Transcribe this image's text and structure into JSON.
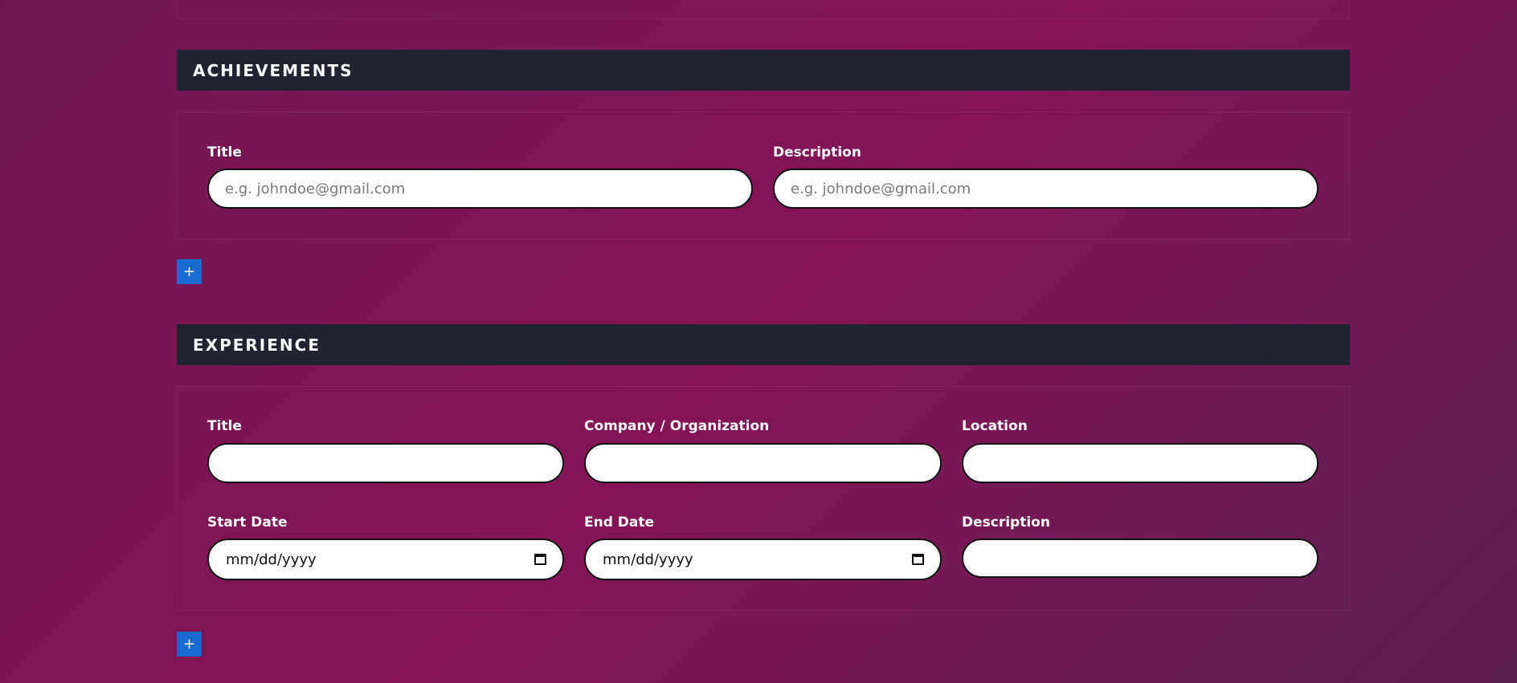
{
  "achievements": {
    "heading": "ACHIEVEMENTS",
    "fields": {
      "title": {
        "label": "Title",
        "value": "",
        "placeholder": "e.g. johndoe@gmail.com"
      },
      "description": {
        "label": "Description",
        "value": "",
        "placeholder": "e.g. johndoe@gmail.com"
      }
    },
    "add_label": "+"
  },
  "experience": {
    "heading": "EXPERIENCE",
    "fields": {
      "title": {
        "label": "Title",
        "value": ""
      },
      "company": {
        "label": "Company / Organization",
        "value": ""
      },
      "location": {
        "label": "Location",
        "value": ""
      },
      "start_date": {
        "label": "Start Date",
        "value": "mm/dd/yyyy"
      },
      "end_date": {
        "label": "End Date",
        "value": "mm/dd/yyyy"
      },
      "description": {
        "label": "Description",
        "value": ""
      }
    },
    "add_label": "+"
  },
  "colors": {
    "header_bg": "#1f2430",
    "add_button": "#1a6bd1",
    "background_gradient": [
      "#6f1650",
      "#841455",
      "#5c1f4f"
    ]
  },
  "icons": {
    "add": "plus-icon",
    "date_picker": "calendar-icon"
  }
}
